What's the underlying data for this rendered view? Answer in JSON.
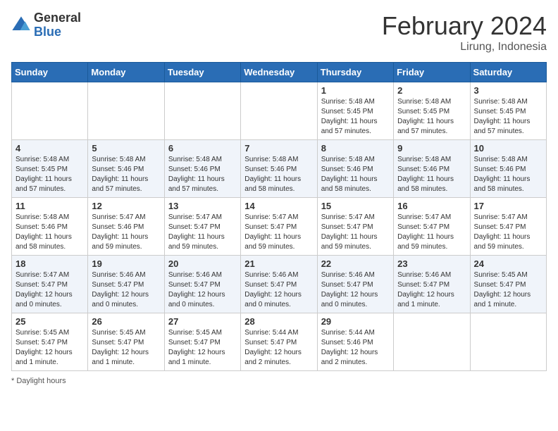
{
  "header": {
    "logo_general": "General",
    "logo_blue": "Blue",
    "month_title": "February 2024",
    "location": "Lirung, Indonesia"
  },
  "columns": [
    "Sunday",
    "Monday",
    "Tuesday",
    "Wednesday",
    "Thursday",
    "Friday",
    "Saturday"
  ],
  "weeks": [
    [
      {
        "day": "",
        "info": ""
      },
      {
        "day": "",
        "info": ""
      },
      {
        "day": "",
        "info": ""
      },
      {
        "day": "",
        "info": ""
      },
      {
        "day": "1",
        "info": "Sunrise: 5:48 AM\nSunset: 5:45 PM\nDaylight: 11 hours\nand 57 minutes."
      },
      {
        "day": "2",
        "info": "Sunrise: 5:48 AM\nSunset: 5:45 PM\nDaylight: 11 hours\nand 57 minutes."
      },
      {
        "day": "3",
        "info": "Sunrise: 5:48 AM\nSunset: 5:45 PM\nDaylight: 11 hours\nand 57 minutes."
      }
    ],
    [
      {
        "day": "4",
        "info": "Sunrise: 5:48 AM\nSunset: 5:45 PM\nDaylight: 11 hours\nand 57 minutes."
      },
      {
        "day": "5",
        "info": "Sunrise: 5:48 AM\nSunset: 5:46 PM\nDaylight: 11 hours\nand 57 minutes."
      },
      {
        "day": "6",
        "info": "Sunrise: 5:48 AM\nSunset: 5:46 PM\nDaylight: 11 hours\nand 57 minutes."
      },
      {
        "day": "7",
        "info": "Sunrise: 5:48 AM\nSunset: 5:46 PM\nDaylight: 11 hours\nand 58 minutes."
      },
      {
        "day": "8",
        "info": "Sunrise: 5:48 AM\nSunset: 5:46 PM\nDaylight: 11 hours\nand 58 minutes."
      },
      {
        "day": "9",
        "info": "Sunrise: 5:48 AM\nSunset: 5:46 PM\nDaylight: 11 hours\nand 58 minutes."
      },
      {
        "day": "10",
        "info": "Sunrise: 5:48 AM\nSunset: 5:46 PM\nDaylight: 11 hours\nand 58 minutes."
      }
    ],
    [
      {
        "day": "11",
        "info": "Sunrise: 5:48 AM\nSunset: 5:46 PM\nDaylight: 11 hours\nand 58 minutes."
      },
      {
        "day": "12",
        "info": "Sunrise: 5:47 AM\nSunset: 5:46 PM\nDaylight: 11 hours\nand 59 minutes."
      },
      {
        "day": "13",
        "info": "Sunrise: 5:47 AM\nSunset: 5:47 PM\nDaylight: 11 hours\nand 59 minutes."
      },
      {
        "day": "14",
        "info": "Sunrise: 5:47 AM\nSunset: 5:47 PM\nDaylight: 11 hours\nand 59 minutes."
      },
      {
        "day": "15",
        "info": "Sunrise: 5:47 AM\nSunset: 5:47 PM\nDaylight: 11 hours\nand 59 minutes."
      },
      {
        "day": "16",
        "info": "Sunrise: 5:47 AM\nSunset: 5:47 PM\nDaylight: 11 hours\nand 59 minutes."
      },
      {
        "day": "17",
        "info": "Sunrise: 5:47 AM\nSunset: 5:47 PM\nDaylight: 11 hours\nand 59 minutes."
      }
    ],
    [
      {
        "day": "18",
        "info": "Sunrise: 5:47 AM\nSunset: 5:47 PM\nDaylight: 12 hours\nand 0 minutes."
      },
      {
        "day": "19",
        "info": "Sunrise: 5:46 AM\nSunset: 5:47 PM\nDaylight: 12 hours\nand 0 minutes."
      },
      {
        "day": "20",
        "info": "Sunrise: 5:46 AM\nSunset: 5:47 PM\nDaylight: 12 hours\nand 0 minutes."
      },
      {
        "day": "21",
        "info": "Sunrise: 5:46 AM\nSunset: 5:47 PM\nDaylight: 12 hours\nand 0 minutes."
      },
      {
        "day": "22",
        "info": "Sunrise: 5:46 AM\nSunset: 5:47 PM\nDaylight: 12 hours\nand 0 minutes."
      },
      {
        "day": "23",
        "info": "Sunrise: 5:46 AM\nSunset: 5:47 PM\nDaylight: 12 hours\nand 1 minute."
      },
      {
        "day": "24",
        "info": "Sunrise: 5:45 AM\nSunset: 5:47 PM\nDaylight: 12 hours\nand 1 minute."
      }
    ],
    [
      {
        "day": "25",
        "info": "Sunrise: 5:45 AM\nSunset: 5:47 PM\nDaylight: 12 hours\nand 1 minute."
      },
      {
        "day": "26",
        "info": "Sunrise: 5:45 AM\nSunset: 5:47 PM\nDaylight: 12 hours\nand 1 minute."
      },
      {
        "day": "27",
        "info": "Sunrise: 5:45 AM\nSunset: 5:47 PM\nDaylight: 12 hours\nand 1 minute."
      },
      {
        "day": "28",
        "info": "Sunrise: 5:44 AM\nSunset: 5:47 PM\nDaylight: 12 hours\nand 2 minutes."
      },
      {
        "day": "29",
        "info": "Sunrise: 5:44 AM\nSunset: 5:46 PM\nDaylight: 12 hours\nand 2 minutes."
      },
      {
        "day": "",
        "info": ""
      },
      {
        "day": "",
        "info": ""
      }
    ]
  ],
  "footer": {
    "note": "Daylight hours"
  }
}
